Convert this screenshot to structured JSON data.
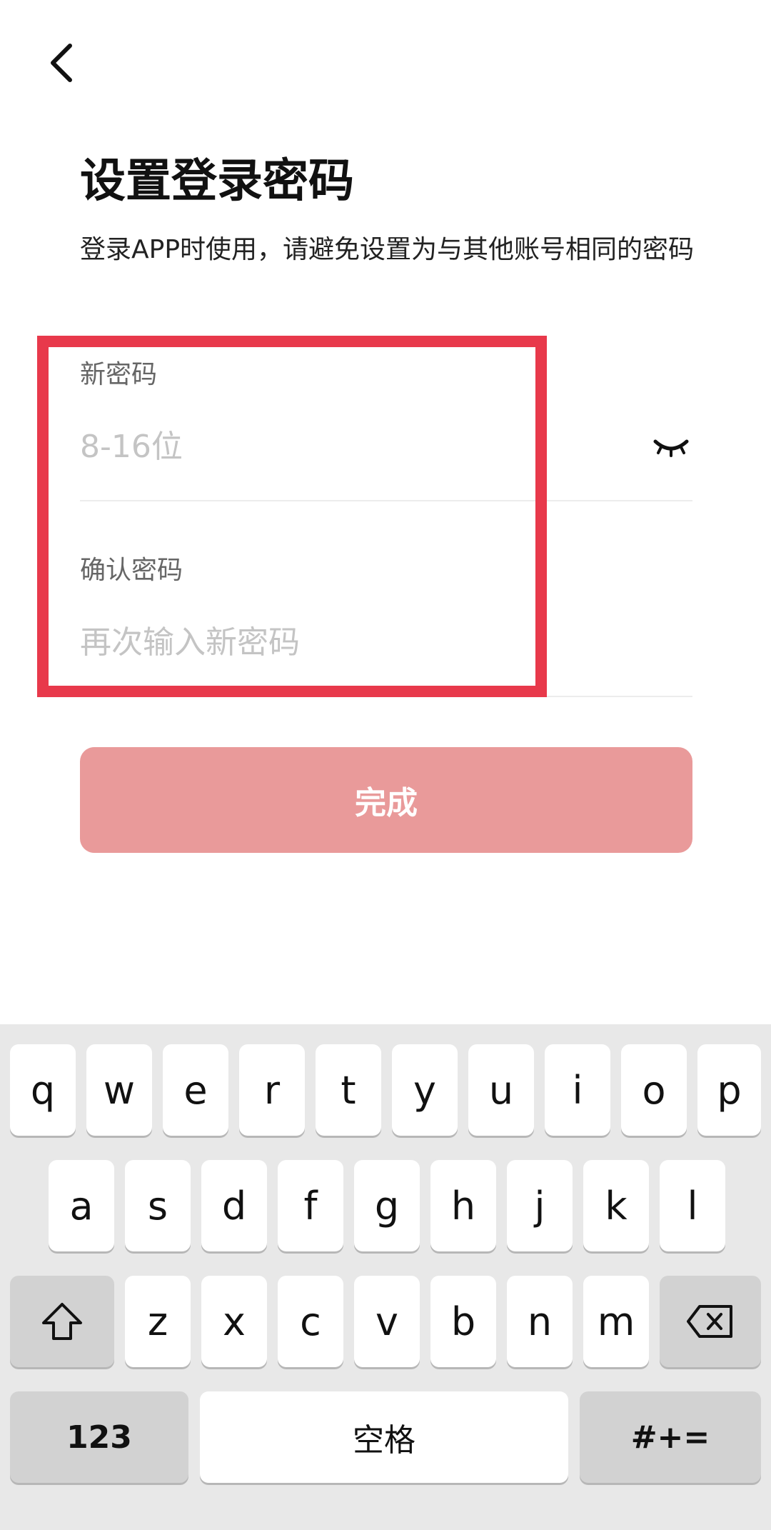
{
  "page": {
    "title": "设置登录密码",
    "subtitle": "登录APP时使用，请避免设置为与其他账号相同的密码"
  },
  "form": {
    "new_password": {
      "label": "新密码",
      "placeholder": "8-16位"
    },
    "confirm_password": {
      "label": "确认密码",
      "placeholder": "再次输入新密码"
    },
    "submit_label": "完成"
  },
  "icons": {
    "back": "chevron-left-icon",
    "eye": "eye-closed-icon",
    "shift": "shift-arrow-icon",
    "delete": "backspace-icon"
  },
  "colors": {
    "submit_disabled": "#e99a9a",
    "highlight": "#e8394b",
    "keyboard_bg": "#e8e8e8"
  },
  "keyboard": {
    "row1": [
      "q",
      "w",
      "e",
      "r",
      "t",
      "y",
      "u",
      "i",
      "o",
      "p"
    ],
    "row2": [
      "a",
      "s",
      "d",
      "f",
      "g",
      "h",
      "j",
      "k",
      "l"
    ],
    "row3": [
      "z",
      "x",
      "c",
      "v",
      "b",
      "n",
      "m"
    ],
    "numbers_label": "123",
    "space_label": "空格",
    "symbols_label": "#+="
  }
}
